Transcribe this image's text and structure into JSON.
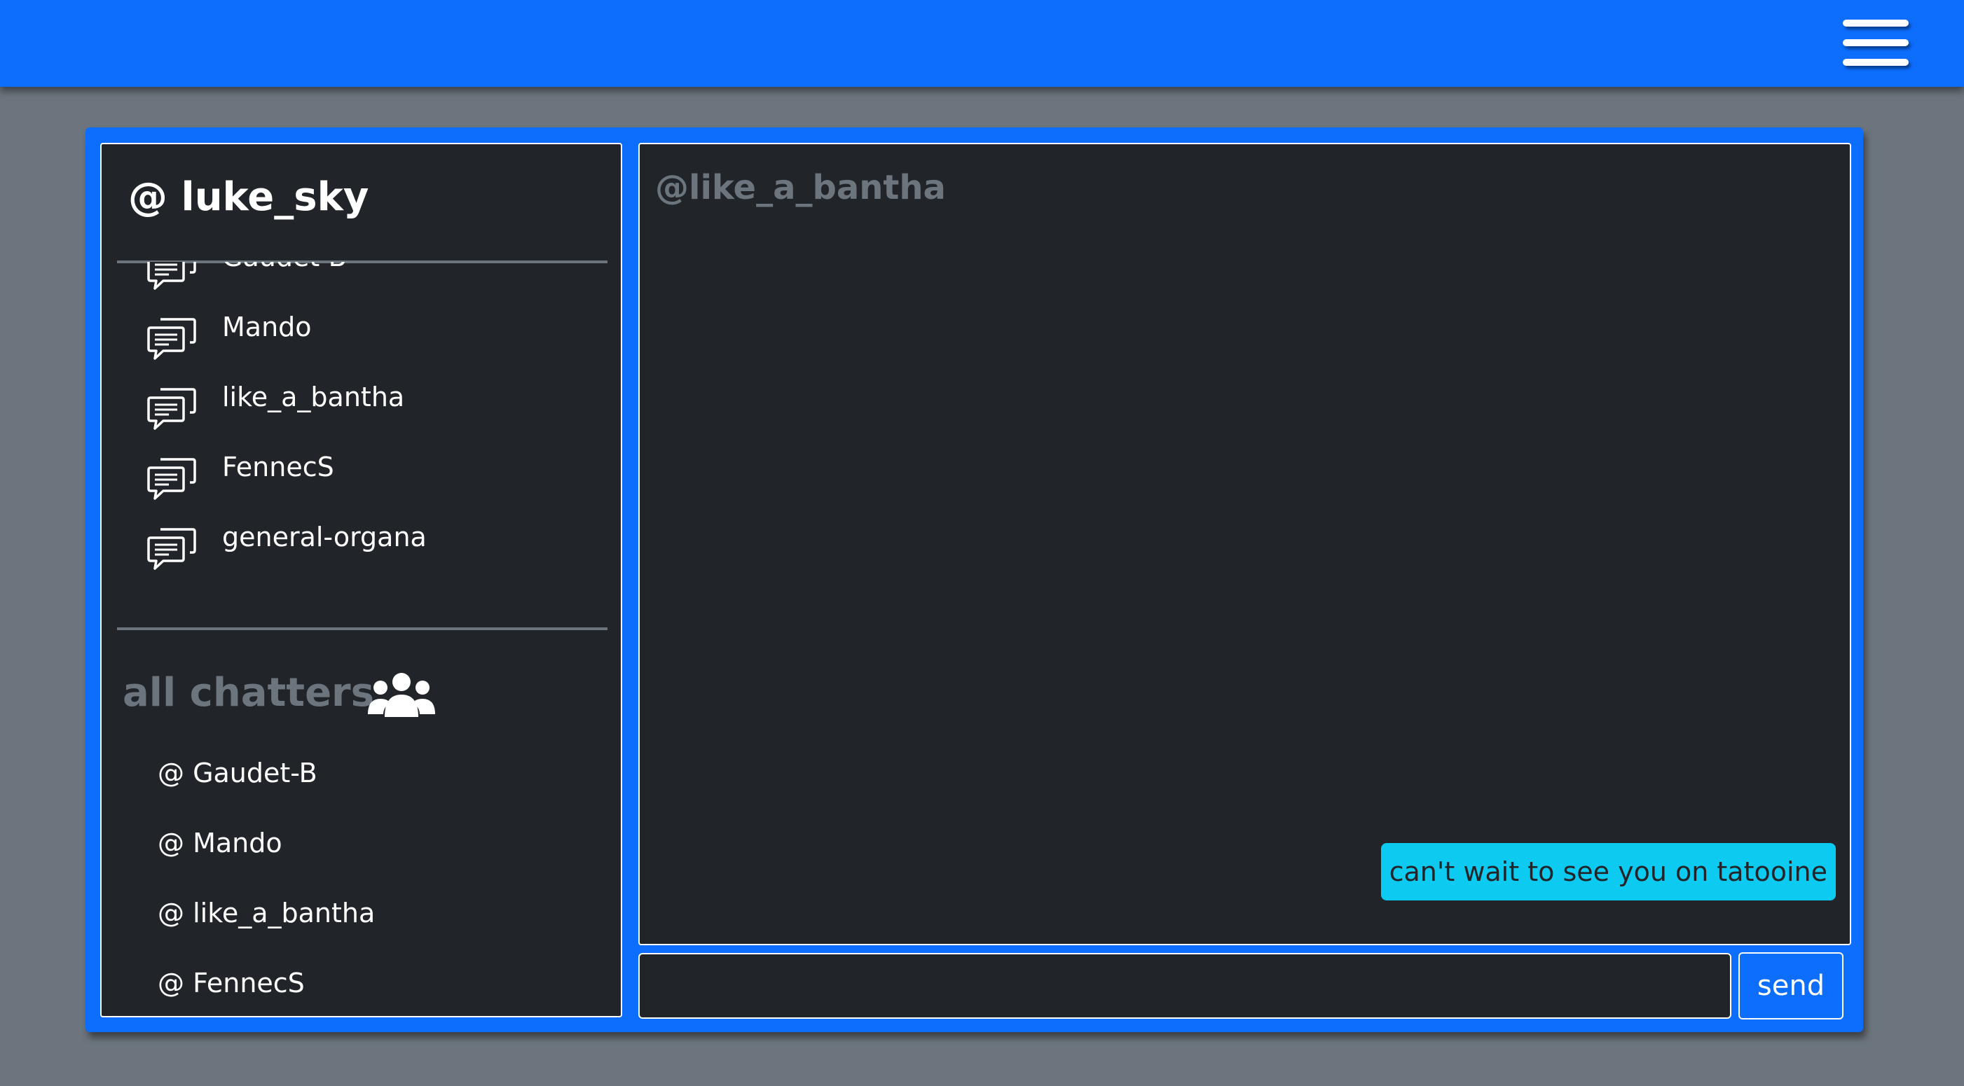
{
  "header": {
    "menu_icon": "hamburger-menu-icon"
  },
  "sidebar": {
    "current_user": "@ luke_sky",
    "conversations": [
      {
        "label": "Gaudet-B",
        "icon": "chat-bubbles-icon"
      },
      {
        "label": "Mando",
        "icon": "chat-bubbles-icon"
      },
      {
        "label": "like_a_bantha",
        "icon": "chat-bubbles-icon"
      },
      {
        "label": "FennecS",
        "icon": "chat-bubbles-icon"
      },
      {
        "label": "general-organa",
        "icon": "chat-bubbles-icon"
      }
    ],
    "all_chatters_heading": "all chatters",
    "all_chatters_icon": "users-group-icon",
    "users": [
      {
        "label": "@ Gaudet-B"
      },
      {
        "label": "@ Mando"
      },
      {
        "label": "@ like_a_bantha"
      },
      {
        "label": "@ FennecS"
      }
    ]
  },
  "chat": {
    "title": "@like_a_bantha",
    "messages": [
      {
        "text": "can't wait to see you on tatooine",
        "from": "self"
      }
    ],
    "input_value": "",
    "input_placeholder": "",
    "send_label": "send"
  },
  "colors": {
    "primary": "#0d6efd",
    "background": "#6c757d",
    "panel": "#212529",
    "message_bubble": "#0dcaf0",
    "muted_text": "#6c757d"
  }
}
